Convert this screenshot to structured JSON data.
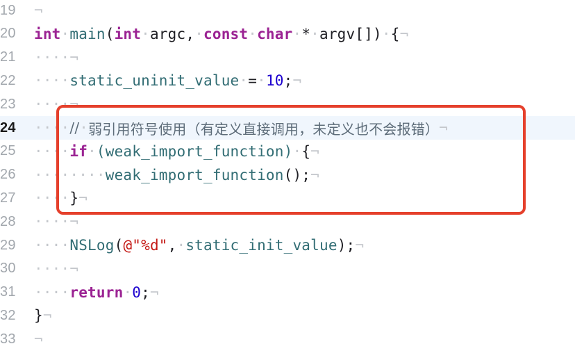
{
  "editor": {
    "lines": [
      {
        "num": "19",
        "indent": "",
        "parts": []
      },
      {
        "num": "20",
        "indent": "",
        "parts": [
          {
            "t": "int",
            "c": "kw"
          },
          {
            "t": "·",
            "c": "ws"
          },
          {
            "t": "main",
            "c": "fn"
          },
          {
            "t": "(",
            "c": "tx"
          },
          {
            "t": "int",
            "c": "kw"
          },
          {
            "t": "·",
            "c": "ws"
          },
          {
            "t": "argc,",
            "c": "tx"
          },
          {
            "t": "·",
            "c": "ws"
          },
          {
            "t": "const",
            "c": "kw"
          },
          {
            "t": "·",
            "c": "ws"
          },
          {
            "t": "char",
            "c": "kw"
          },
          {
            "t": "·",
            "c": "ws"
          },
          {
            "t": "*",
            "c": "tx"
          },
          {
            "t": "·",
            "c": "ws"
          },
          {
            "t": "argv[])",
            "c": "tx"
          },
          {
            "t": "·",
            "c": "ws"
          },
          {
            "t": "{",
            "c": "tx"
          }
        ]
      },
      {
        "num": "21",
        "indent": "····",
        "parts": []
      },
      {
        "num": "22",
        "indent": "····",
        "parts": [
          {
            "t": "static_uninit_value",
            "c": "id"
          },
          {
            "t": "·",
            "c": "ws"
          },
          {
            "t": "=",
            "c": "tx"
          },
          {
            "t": "·",
            "c": "ws"
          },
          {
            "t": "10",
            "c": "num"
          },
          {
            "t": ";",
            "c": "tx"
          }
        ]
      },
      {
        "num": "23",
        "indent": "····",
        "parts": []
      },
      {
        "num": "24",
        "indent": "····",
        "current": true,
        "parts": [
          {
            "t": "//",
            "c": "cmt"
          },
          {
            "t": "·",
            "c": "ws"
          },
          {
            "t": "弱引用符号使用（有定义直接调用，未定义也不会报错）",
            "c": "cmt"
          }
        ]
      },
      {
        "num": "25",
        "indent": "····",
        "parts": [
          {
            "t": "if",
            "c": "kw"
          },
          {
            "t": "·",
            "c": "ws"
          },
          {
            "t": "(weak_import_function)",
            "c": "id"
          },
          {
            "t": "·",
            "c": "ws"
          },
          {
            "t": "{",
            "c": "tx"
          }
        ]
      },
      {
        "num": "26",
        "indent": "········",
        "parts": [
          {
            "t": "weak_import_function",
            "c": "id"
          },
          {
            "t": "();",
            "c": "tx"
          }
        ]
      },
      {
        "num": "27",
        "indent": "····",
        "parts": [
          {
            "t": "}",
            "c": "tx"
          }
        ]
      },
      {
        "num": "28",
        "indent": "····",
        "parts": []
      },
      {
        "num": "29",
        "indent": "····",
        "parts": [
          {
            "t": "NSLog",
            "c": "id"
          },
          {
            "t": "(",
            "c": "tx"
          },
          {
            "t": "@\"%d\"",
            "c": "str"
          },
          {
            "t": ",",
            "c": "tx"
          },
          {
            "t": "·",
            "c": "ws"
          },
          {
            "t": "static_init_value",
            "c": "id"
          },
          {
            "t": ");",
            "c": "tx"
          }
        ]
      },
      {
        "num": "30",
        "indent": "····",
        "parts": []
      },
      {
        "num": "31",
        "indent": "····",
        "parts": [
          {
            "t": "return",
            "c": "kw"
          },
          {
            "t": "·",
            "c": "ws"
          },
          {
            "t": "0",
            "c": "num"
          },
          {
            "t": ";",
            "c": "tx"
          }
        ]
      },
      {
        "num": "32",
        "indent": "",
        "parts": [
          {
            "t": "}",
            "c": "tx"
          }
        ]
      },
      {
        "num": "33",
        "indent": "",
        "parts": []
      }
    ],
    "eol_marker": "¬"
  }
}
